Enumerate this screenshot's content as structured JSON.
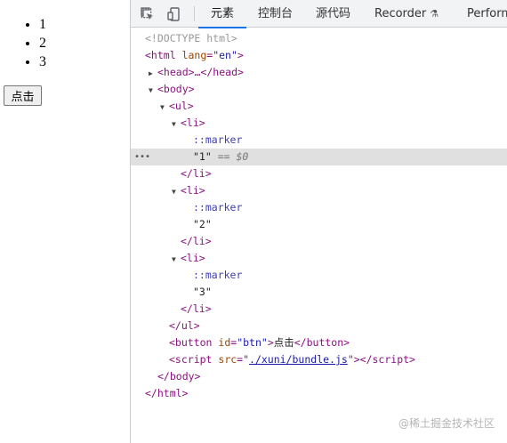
{
  "preview": {
    "list_items": [
      "1",
      "2",
      "3"
    ],
    "button_label": "点击"
  },
  "devtools": {
    "tools": [
      {
        "name": "inspect-element-icon"
      },
      {
        "name": "device-toolbar-icon"
      }
    ],
    "tabs": [
      {
        "label": "元素",
        "active": true
      },
      {
        "label": "控制台"
      },
      {
        "label": "源代码"
      },
      {
        "label": "Recorder"
      },
      {
        "label": "Perform"
      }
    ],
    "recorder_icon": "flask-icon",
    "accent_color": "#1a73e8",
    "selected_line_color": "#e0e0e0"
  },
  "tree": {
    "doctype": "<!DOCTYPE html>",
    "html_lang_value": "\"en\"",
    "head_collapsed": "<head>…</head>",
    "marker": "::marker",
    "li_texts": [
      "\"1\"",
      "\"2\"",
      "\"3\""
    ],
    "selected_suffix": "== $0",
    "button_id_value": "\"btn\"",
    "button_text": "点击",
    "script_src_value": "./xuni/bundle.js"
  },
  "watermark": "@稀土掘金技术社区"
}
